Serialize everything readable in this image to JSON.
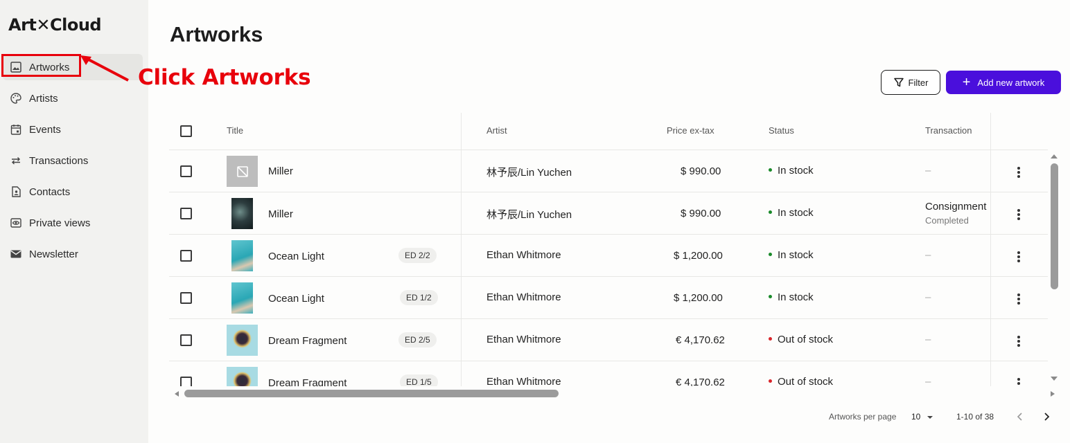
{
  "sidebar": {
    "logo": "Art✕Cloud",
    "items": [
      {
        "label": "Artworks",
        "icon": "image-icon",
        "active": true
      },
      {
        "label": "Artists",
        "icon": "palette-icon"
      },
      {
        "label": "Events",
        "icon": "calendar-icon"
      },
      {
        "label": "Transactions",
        "icon": "swap-arrows-icon"
      },
      {
        "label": "Contacts",
        "icon": "contact-icon"
      },
      {
        "label": "Private views",
        "icon": "eye-icon"
      },
      {
        "label": "Newsletter",
        "icon": "mail-icon"
      }
    ]
  },
  "annotation": {
    "text": "Click Artworks",
    "color": "#e8000b"
  },
  "main": {
    "title": "Artworks",
    "filter_label": "Filter",
    "add_label": "Add new artwork",
    "accent_color": "#4a0fdc"
  },
  "table": {
    "headers": {
      "title": "Title",
      "artist": "Artist",
      "price": "Price ex-tax",
      "status": "Status",
      "transaction": "Transaction"
    },
    "rows": [
      {
        "title": "Miller",
        "edition": "",
        "artist": "林予辰/Lin Yuchen",
        "price": "$  990.00",
        "status": "In stock",
        "status_color": "#1a8a2a",
        "transaction": "–",
        "transaction_sub": "",
        "thumb": "placeholder"
      },
      {
        "title": "Miller",
        "edition": "",
        "artist": "林予辰/Lin Yuchen",
        "price": "$  990.00",
        "status": "In stock",
        "status_color": "#1a8a2a",
        "transaction": "Consignment",
        "transaction_sub": "Completed",
        "thumb": "dark"
      },
      {
        "title": "Ocean Light",
        "edition": "ED 2/2",
        "artist": "Ethan Whitmore",
        "price": "$  1,200.00",
        "status": "In stock",
        "status_color": "#1a8a2a",
        "transaction": "–",
        "transaction_sub": "",
        "thumb": "ocean"
      },
      {
        "title": "Ocean Light",
        "edition": "ED 1/2",
        "artist": "Ethan Whitmore",
        "price": "$  1,200.00",
        "status": "In stock",
        "status_color": "#1a8a2a",
        "transaction": "–",
        "transaction_sub": "",
        "thumb": "ocean"
      },
      {
        "title": "Dream Fragment",
        "edition": "ED 2/5",
        "artist": "Ethan Whitmore",
        "price": "€  4,170.62",
        "status": "Out of stock",
        "status_color": "#d9262b",
        "transaction": "–",
        "transaction_sub": "",
        "thumb": "portrait"
      },
      {
        "title": "Dream Fragment",
        "edition": "ED 1/5",
        "artist": "Ethan Whitmore",
        "price": "€  4,170.62",
        "status": "Out of stock",
        "status_color": "#d9262b",
        "transaction": "–",
        "transaction_sub": "",
        "thumb": "portrait"
      }
    ]
  },
  "footer": {
    "per_page_label": "Artworks per page",
    "per_page_value": "10",
    "range": "1-10 of 38"
  }
}
